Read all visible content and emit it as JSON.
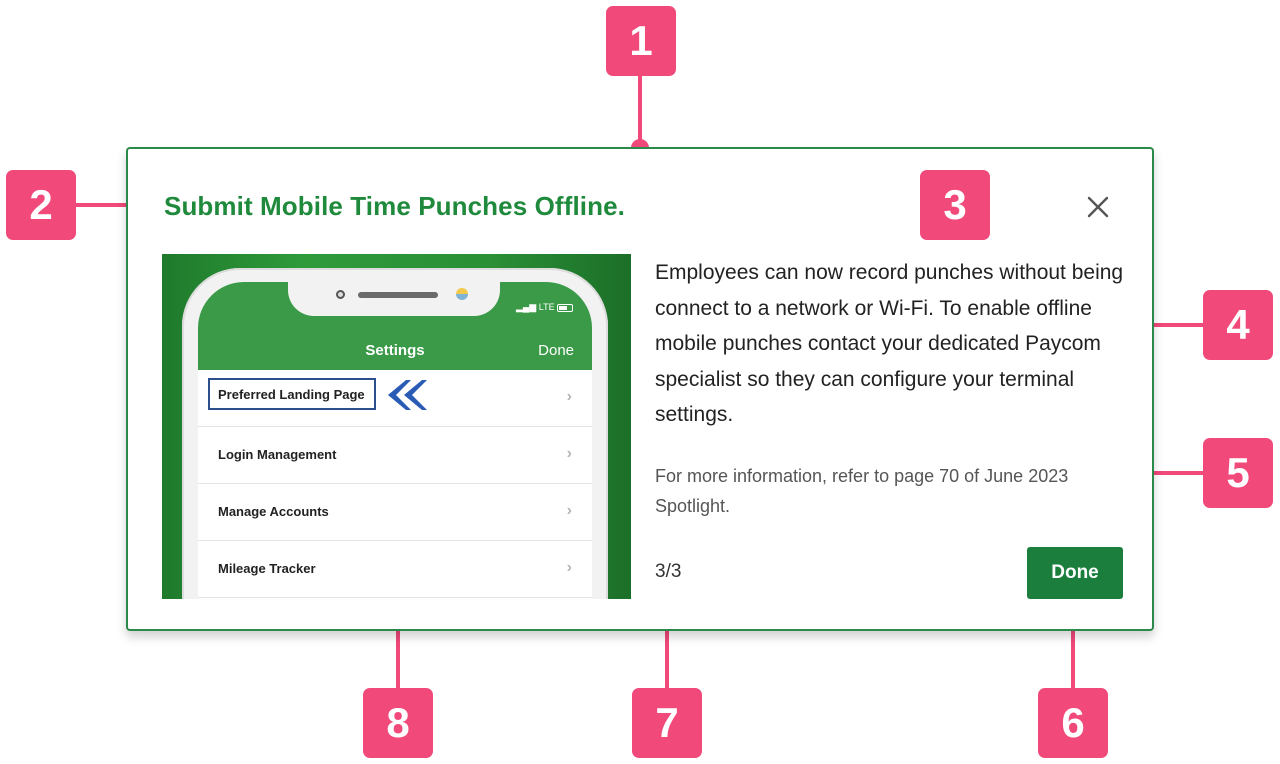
{
  "dialog": {
    "title": "Submit Mobile Time Punches Offline.",
    "body": "Employees can now record punches without being connect to a network or Wi-Fi. To enable offline mobile punches contact your dedicated Paycom specialist so they can configure your terminal settings.",
    "more_info": "For more information, refer to page 70 of June 2023 Spotlight.",
    "step_counter": "3/3",
    "done_label": "Done",
    "close_icon": "close-icon"
  },
  "phone_screenshot": {
    "status": "LTE",
    "screen_title": "Settings",
    "screen_done": "Done",
    "rows": [
      "Preferred Landing Page",
      "Login Management",
      "Manage Accounts",
      "Mileage Tracker"
    ],
    "chevron": "›"
  },
  "annotations": [
    "1",
    "2",
    "3",
    "4",
    "5",
    "6",
    "7",
    "8"
  ],
  "colors": {
    "accent_green": "#1f8a3b",
    "button_green": "#1b7e3d",
    "callout_pink": "#f0497a",
    "highlight_blue": "#2c4f8c"
  }
}
